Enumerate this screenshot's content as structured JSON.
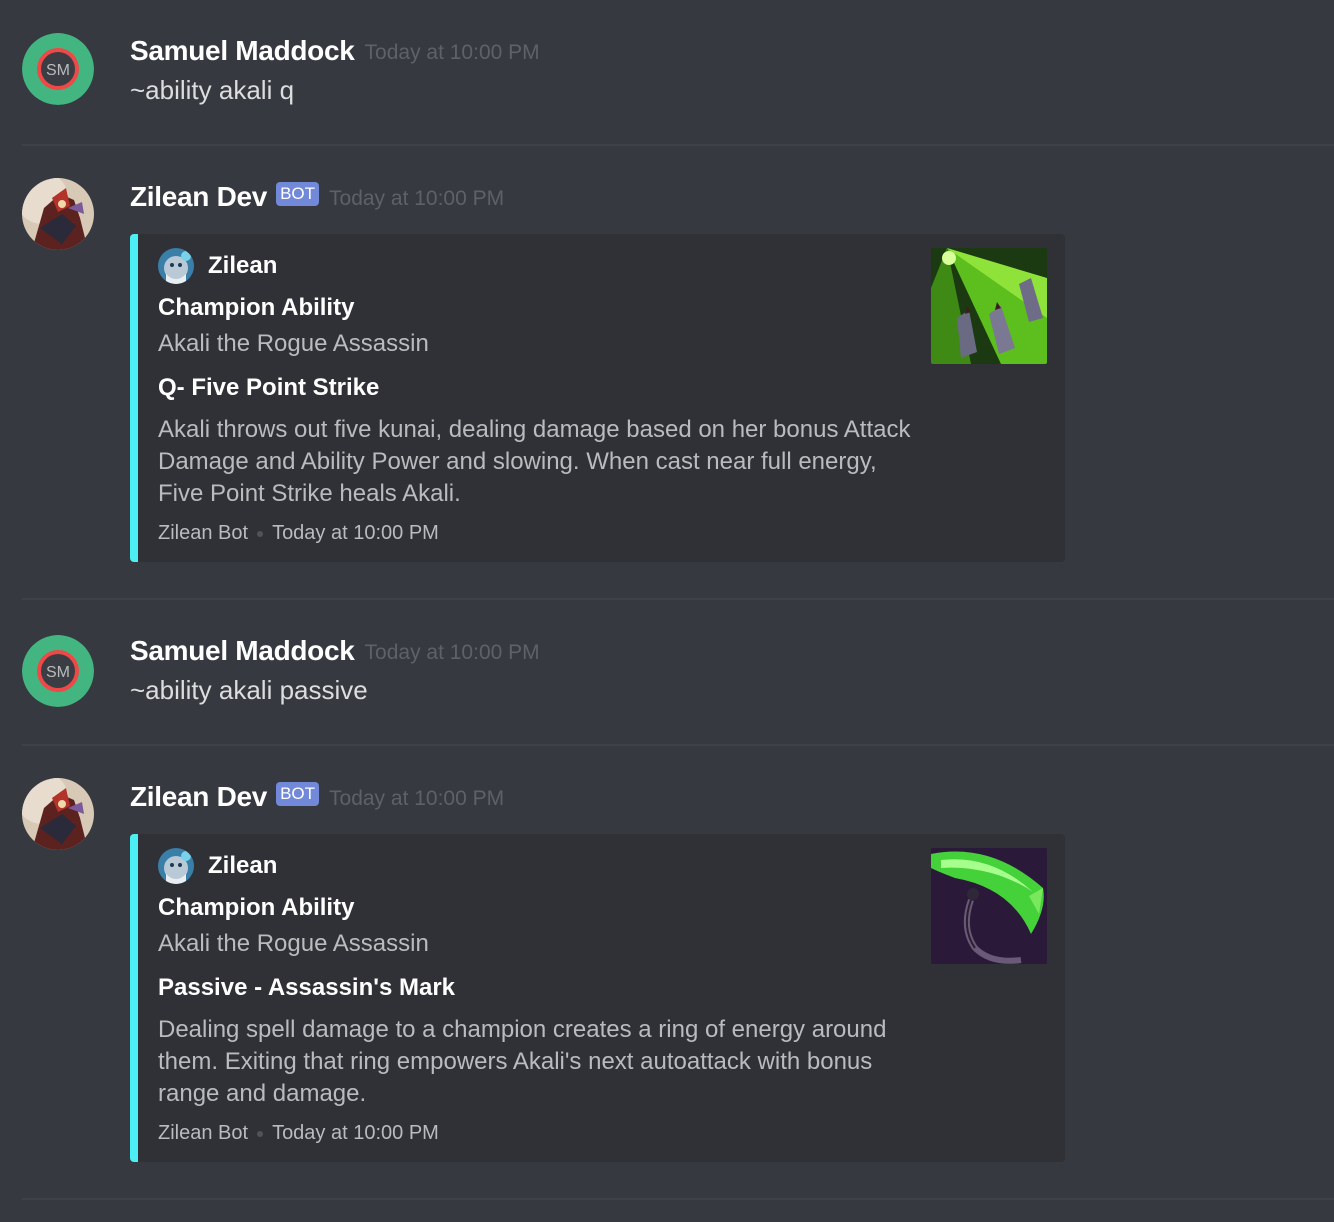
{
  "messages": [
    {
      "author": "Samuel Maddock",
      "avatar_initials": "SM",
      "timestamp": "Today at 10:00 PM",
      "content": "~ability akali q"
    },
    {
      "author": "Zilean Dev",
      "bot_tag": "BOT",
      "timestamp": "Today at 10:00 PM",
      "embed": {
        "color": "#4cf0f4",
        "author_name": "Zilean",
        "title": "Champion Ability",
        "description": "Akali the Rogue Assassin",
        "field_name": "Q- Five Point Strike",
        "field_value_lines": [
          "Akali throws out five kunai, dealing damage based on her bonus Attack",
          "Damage and Ability Power and slowing. When cast near full energy,",
          "Five Point Strike heals Akali."
        ],
        "footer_text": "Zilean Bot",
        "footer_timestamp": "Today at 10:00 PM",
        "thumbnail_icon": "five-point-strike-icon"
      }
    },
    {
      "author": "Samuel Maddock",
      "avatar_initials": "SM",
      "timestamp": "Today at 10:00 PM",
      "content": "~ability akali passive"
    },
    {
      "author": "Zilean Dev",
      "bot_tag": "BOT",
      "timestamp": "Today at 10:00 PM",
      "embed": {
        "color": "#4cf0f4",
        "author_name": "Zilean",
        "title": "Champion Ability",
        "description": "Akali the Rogue Assassin",
        "field_name": "Passive - Assassin's Mark",
        "field_value_lines": [
          "Dealing spell damage to a champion creates a ring of energy around",
          "them. Exiting that ring empowers Akali's next autoattack with bonus",
          "range and damage."
        ],
        "footer_text": "Zilean Bot",
        "footer_timestamp": "Today at 10:00 PM",
        "thumbnail_icon": "assassins-mark-icon"
      }
    }
  ],
  "colors": {
    "background": "#36393f",
    "embed_background": "#2f3136",
    "embed_accent": "#4cf0f4",
    "bot_tag": "#7289da",
    "timestamp": "#5d6168",
    "avatar_green": "#43b581",
    "avatar_red": "#f04747"
  }
}
